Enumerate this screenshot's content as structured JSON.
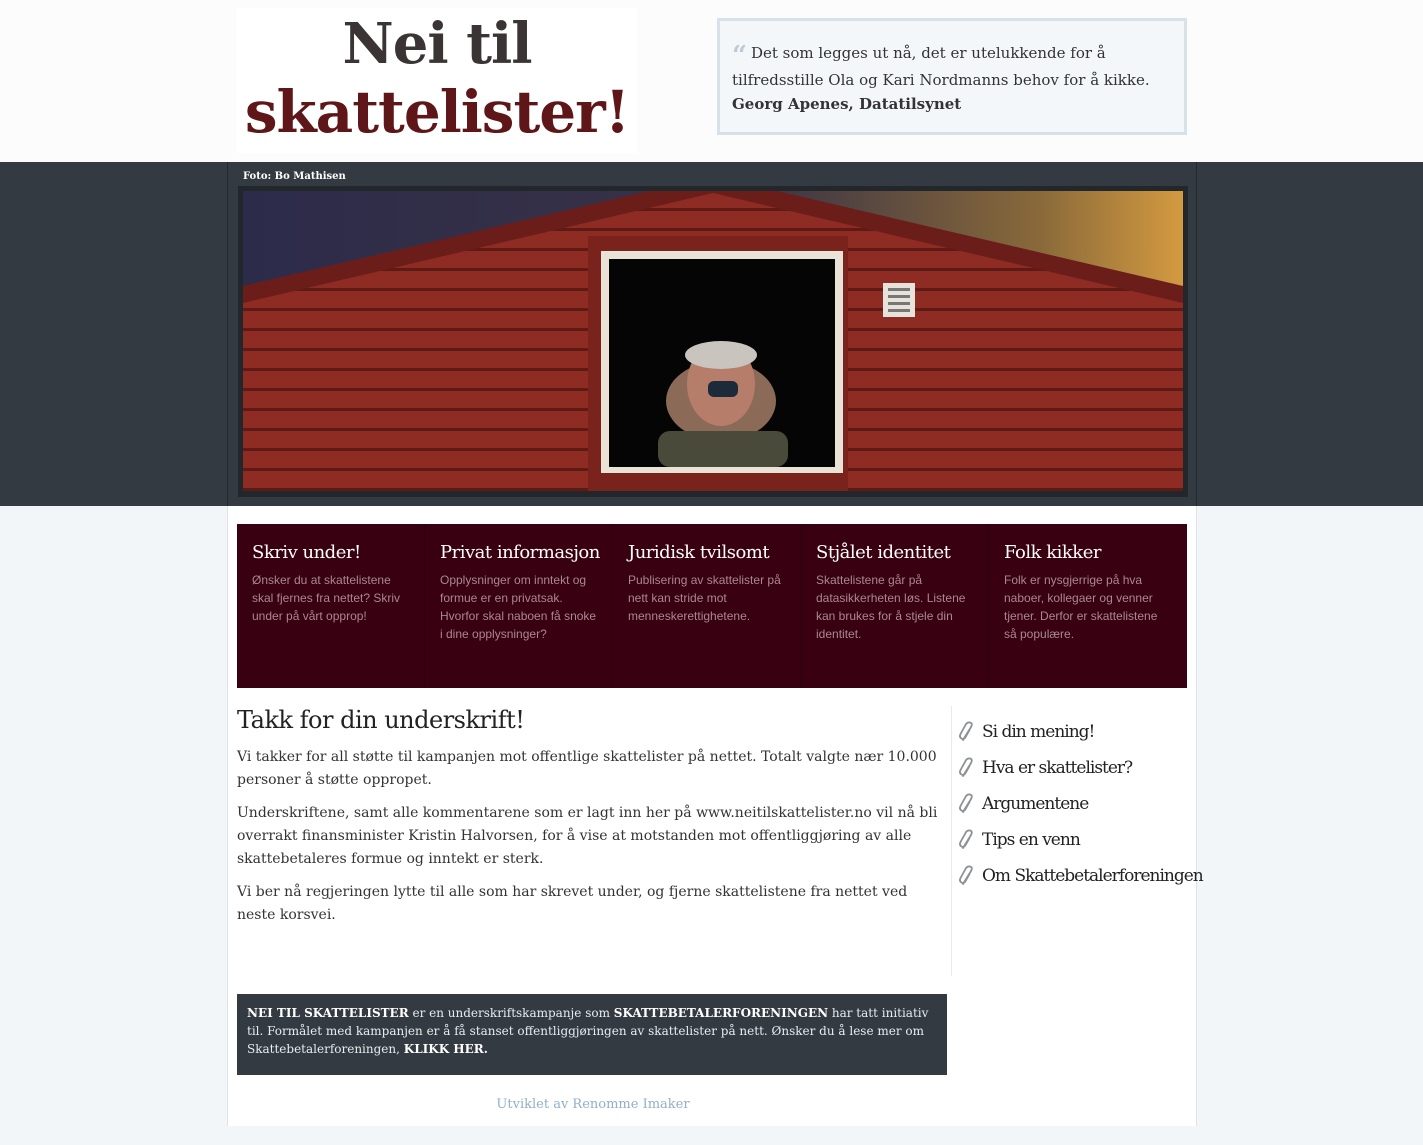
{
  "header": {
    "logo_line1": "Nei til",
    "logo_line2": "skattelister!",
    "quote": {
      "mark": "“",
      "text": "Det som legges ut nå, det er utelukkende for å tilfredsstille Ola og Kari Nordmanns behov for å kikke.",
      "author": "Georg Apenes, Datatilsynet"
    }
  },
  "hero": {
    "photo_credit": "Foto: Bo Mathisen"
  },
  "features": [
    {
      "title": "Skriv under!",
      "text": "Ønsker du at skattelistene skal fjernes fra nettet? Skriv under på vårt opprop!"
    },
    {
      "title": "Privat informasjon",
      "text": "Opplysninger om inntekt og formue er en privatsak. Hvorfor skal naboen få snoke i dine opplysninger?"
    },
    {
      "title": "Juridisk tvilsomt",
      "text": "Publisering av skattelister på nett kan stride mot menneskerettighetene."
    },
    {
      "title": "Stjålet identitet",
      "text": "Skattelistene går på datasikkerheten løs. Listene kan brukes for å stjele din identitet."
    },
    {
      "title": "Folk kikker",
      "text": "Folk er nysgjerrige på hva naboer, kollegaer og venner tjener. Derfor er skattelistene så populære."
    }
  ],
  "article": {
    "title": "Takk for din underskrift!",
    "paragraphs": [
      "Vi takker for all støtte til kampanjen mot offentlige skattelister på nettet. Totalt valgte nær 10.000 personer å støtte oppropet.",
      "Underskriftene, samt alle kommentarene som er lagt inn her på www.neitilskattelister.no vil nå bli overrakt finansminister Kristin Halvorsen, for å vise at motstanden mot offentliggjøring av alle skattebetaleres formue og inntekt er sterk.",
      "Vi ber nå regjeringen lytte til alle som har skrevet under, og fjerne skattelistene fra nettet ved neste korsvei."
    ]
  },
  "sidebar": {
    "links": [
      "Si din mening!",
      "Hva er skattelister?",
      "Argumentene",
      "Tips en venn",
      "Om Skattebetalerforeningen"
    ],
    "icon": "paperclip-icon"
  },
  "info": {
    "bold1": "NEI TIL SKATTELISTER",
    "text1": " er en underskriftskampanje som ",
    "bold2": "SKATTEBETALERFORENINGEN",
    "text2": " har tatt initiativ til. Formålet med kampanjen er å få stanset offentliggjøringen av skattelister på nett. Ønsker du å lese mer om Skattebetalerforeningen, ",
    "link": "KLIKK HER."
  },
  "footer": {
    "credit": "Utviklet av Renomme Imaker"
  },
  "colors": {
    "dark_band": "#343a41",
    "feature_bg": "#380010",
    "logo_red": "#5e1618",
    "logo_dark": "#3a3434",
    "credit_link": "#8fb0c9"
  }
}
